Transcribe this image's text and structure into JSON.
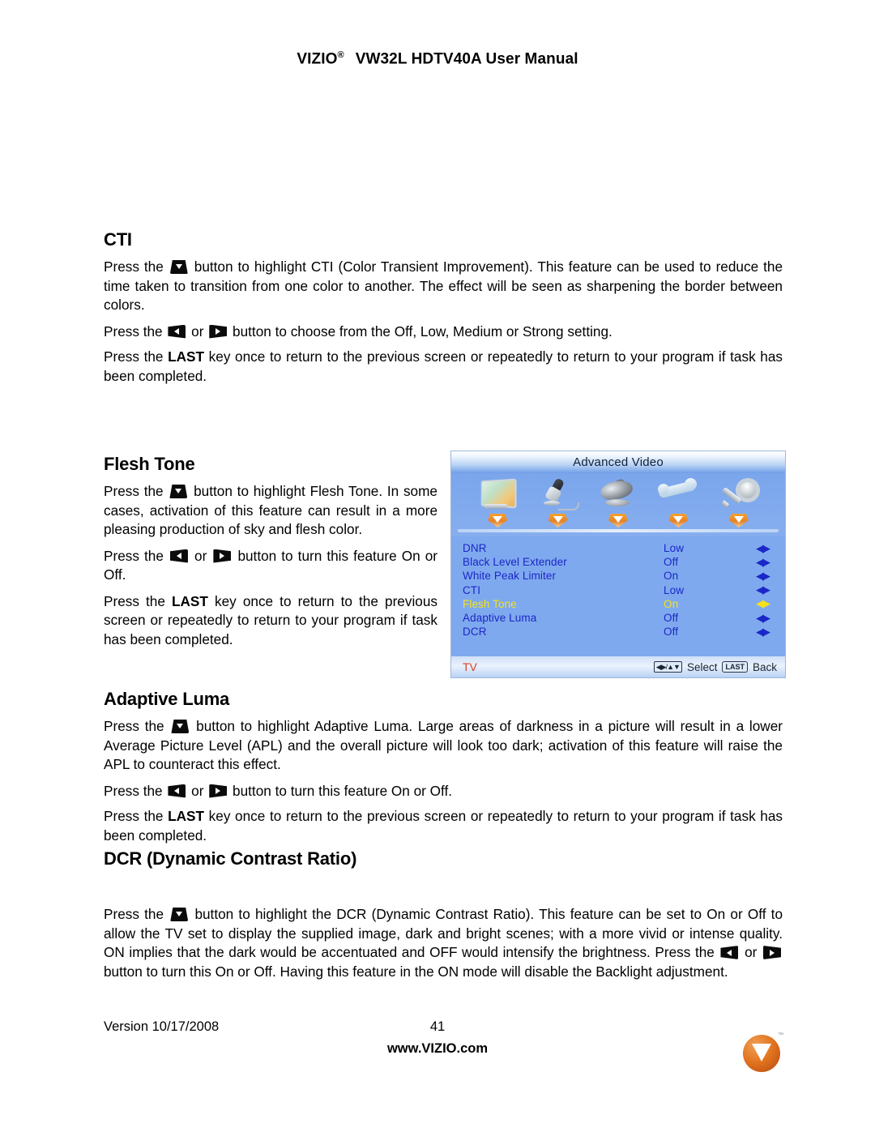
{
  "header": {
    "brand": "VIZIO",
    "brand_sup": "®",
    "title": "VW32L HDTV40A User Manual"
  },
  "sections": {
    "cti": {
      "heading": "CTI",
      "p1_a": "Press the",
      "p1_b": "button to highlight CTI (Color Transient Improvement).  This feature can be used to reduce the time taken to transition from one color to another.  The effect will be seen as sharpening the border between colors.",
      "p2_a": "Press the",
      "p2_mid": "or",
      "p2_b": "button to choose from the Off, Low, Medium or Strong setting.",
      "p3_a": "Press the",
      "p3_key": "LAST",
      "p3_b": "key once to return to the previous screen or repeatedly to return to your program if task has been completed."
    },
    "flesh_tone": {
      "heading": "Flesh Tone",
      "p1_a": "Press the",
      "p1_b": "button to highlight Flesh Tone.  In some cases, activation of this feature can result in a more pleasing production of sky and flesh color.",
      "p2_a": "Press the",
      "p2_mid": "or",
      "p2_b": "button to turn this feature On or Off.",
      "p3_a": "Press the",
      "p3_key": "LAST",
      "p3_b": "key once to return to the previous screen or repeatedly to return to your program if task has been completed."
    },
    "adaptive_luma": {
      "heading": "Adaptive Luma",
      "p1_a": "Press the",
      "p1_b": "button to highlight Adaptive Luma.  Large areas of darkness in a picture will result in a lower Average Picture Level (APL) and the overall picture will look too dark; activation of this feature will raise the APL to counteract this effect.",
      "p2_a": "Press the",
      "p2_mid": "or",
      "p2_b": "button to turn this feature On or Off.",
      "p3_a": "Press the",
      "p3_key": "LAST",
      "p3_b": "key once to return to the previous screen or repeatedly to return to your program if task has been completed."
    },
    "dcr": {
      "heading": "DCR (Dynamic Contrast Ratio)",
      "p1_a": "Press the",
      "p1_b": "button to highlight the DCR (Dynamic Contrast Ratio). This feature can be set to On or Off to allow the TV set to display the supplied image, dark and bright scenes; with a more vivid or intense quality. ON implies that the dark would be accentuated and OFF would intensify the brightness.  Press the",
      "p1_mid": "or",
      "p1_c": "button to turn this On or Off. Having this feature in the ON mode will disable the Backlight adjustment."
    }
  },
  "osd": {
    "title": "Advanced Video",
    "icons": [
      {
        "name": "tv-icon",
        "label": "Picture"
      },
      {
        "name": "microphone-icon",
        "label": "Audio"
      },
      {
        "name": "satellite-dish-icon",
        "label": "Tuner"
      },
      {
        "name": "wrench-icon",
        "label": "Setup"
      },
      {
        "name": "key-icon",
        "label": "Parental"
      }
    ],
    "rows": [
      {
        "label": "DNR",
        "value": "Low",
        "highlighted": false
      },
      {
        "label": "Black Level Extender",
        "value": "Off",
        "highlighted": false
      },
      {
        "label": "White Peak Limiter",
        "value": "On",
        "highlighted": false
      },
      {
        "label": "CTI",
        "value": "Low",
        "highlighted": false
      },
      {
        "label": "Flesh Tone",
        "value": "On",
        "highlighted": true
      },
      {
        "label": "Adaptive Luma",
        "value": "Off",
        "highlighted": false
      },
      {
        "label": "DCR",
        "value": "Off",
        "highlighted": false
      }
    ],
    "arrow_glyph": "◀▶",
    "footer": {
      "source": "TV",
      "pad_glyph": "◀▶/▲▼",
      "select_label": "Select",
      "last_key": "LAST",
      "back_label": "Back"
    },
    "colors": {
      "background": "#7fa9ee",
      "item_text": "#1b27c8",
      "highlight_text": "#f4e11c",
      "source_text": "#d8402a"
    }
  },
  "footer": {
    "version": "Version 10/17/2008",
    "page_number": "41",
    "website": "www.VIZIO.com",
    "logo_letter": "V",
    "logo_tm": "™",
    "logo_color": "#e2731f"
  }
}
